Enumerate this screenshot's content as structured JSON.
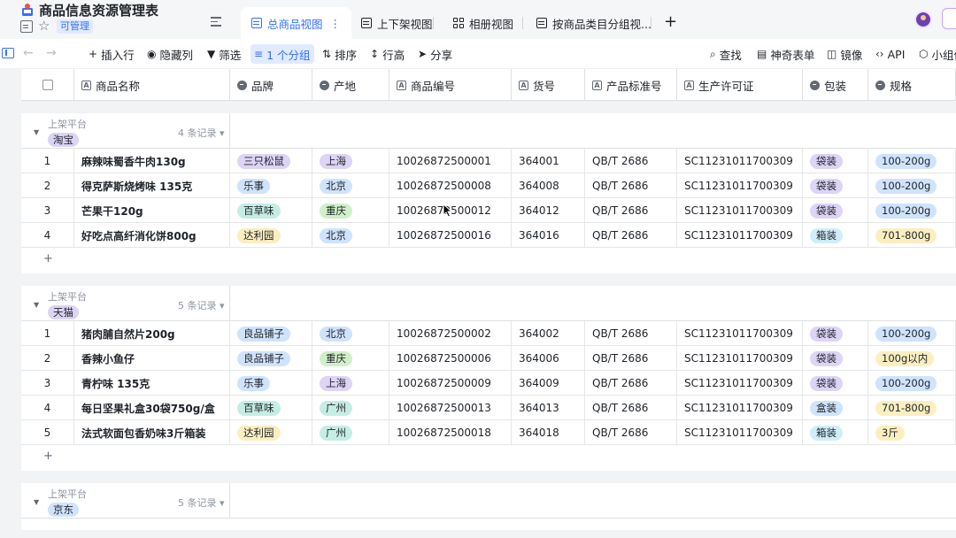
{
  "app": {
    "title": "商品信息资源管理表",
    "permission_badge": "可管理"
  },
  "tabs": [
    {
      "label": "总商品视图",
      "active": true,
      "icon": "grid-view-icon"
    },
    {
      "label": "上下架视图",
      "active": false,
      "icon": "grid-view-icon"
    },
    {
      "label": "相册视图",
      "active": false,
      "icon": "gallery-view-icon"
    },
    {
      "label": "按商品类目分组视...",
      "active": false,
      "icon": "grid-view-icon"
    }
  ],
  "toolbar": {
    "insert_row": "插入行",
    "hide_columns": "隐藏列",
    "filter": "筛选",
    "group": "1 个分组",
    "sort": "排序",
    "row_height": "行高",
    "share": "分享",
    "search": "查找",
    "magic_form": "神奇表单",
    "mirror": "镜像",
    "api": "API",
    "widget": "小组件"
  },
  "columns": [
    "商品名称",
    "品牌",
    "产地",
    "商品编号",
    "货号",
    "产品标准号",
    "生产许可证",
    "包装",
    "规格"
  ],
  "colors": {
    "accent": "#3370ff",
    "brand": {
      "三只松鼠": "#ddd4f7",
      "乐事": "#d0e3fc",
      "百草味": "#c5ede3",
      "达利园": "#fbefc0",
      "良品铺子": "#d0e3fc"
    },
    "origin": {
      "上海": "#ddd4f7",
      "北京": "#d0e3fc",
      "重庆": "#d0f0c8",
      "广州": "#c5ede3"
    },
    "package": {
      "袋装": "#ddd4f7",
      "箱装": "#d0eef9",
      "盒装": "#d0e3fc"
    },
    "spec": {
      "100-200g": "#d0e3fc",
      "701-800g": "#fbefc0",
      "100g以内": "#fbefc0",
      "3斤": "#fbefc0"
    }
  },
  "groups": [
    {
      "field": "上架平台",
      "tag": "淘宝",
      "tag_color": "#dcd3f5",
      "count_label": "4 条记录",
      "rows": [
        {
          "idx": "1",
          "name": "麻辣味蜀香牛肉130g",
          "brand": "三只松鼠",
          "origin": "上海",
          "code": "10026872500001",
          "sku": "364001",
          "std": "QB/T 2686",
          "license": "SC11231011700309",
          "package": "袋装",
          "spec": "100-200g"
        },
        {
          "idx": "2",
          "name": "得克萨斯烧烤味 135克",
          "brand": "乐事",
          "origin": "北京",
          "code": "10026872500008",
          "sku": "364008",
          "std": "QB/T 2686",
          "license": "SC11231011700309",
          "package": "袋装",
          "spec": "100-200g"
        },
        {
          "idx": "3",
          "name": "芒果干120g",
          "brand": "百草味",
          "origin": "重庆",
          "code": "10026872500012",
          "sku": "364012",
          "std": "QB/T 2686",
          "license": "SC11231011700309",
          "package": "袋装",
          "spec": "100-200g"
        },
        {
          "idx": "4",
          "name": "好吃点高纤消化饼800g",
          "brand": "达利园",
          "origin": "北京",
          "code": "10026872500016",
          "sku": "364016",
          "std": "QB/T 2686",
          "license": "SC11231011700309",
          "package": "箱装",
          "spec": "701-800g"
        }
      ]
    },
    {
      "field": "上架平台",
      "tag": "天猫",
      "tag_color": "#dcd3f5",
      "count_label": "5 条记录",
      "rows": [
        {
          "idx": "1",
          "name": "猪肉脯自然片200g",
          "brand": "良品铺子",
          "origin": "北京",
          "code": "10026872500002",
          "sku": "364002",
          "std": "QB/T 2686",
          "license": "SC11231011700309",
          "package": "袋装",
          "spec": "100-200g"
        },
        {
          "idx": "2",
          "name": "香辣小鱼仔",
          "brand": "良品铺子",
          "origin": "重庆",
          "code": "10026872500006",
          "sku": "364006",
          "std": "QB/T 2686",
          "license": "SC11231011700309",
          "package": "袋装",
          "spec": "100g以内"
        },
        {
          "idx": "3",
          "name": "青柠味 135克",
          "brand": "乐事",
          "origin": "上海",
          "code": "10026872500009",
          "sku": "364009",
          "std": "QB/T 2686",
          "license": "SC11231011700309",
          "package": "袋装",
          "spec": "100-200g"
        },
        {
          "idx": "4",
          "name": "每日坚果礼盒30袋750g/盒",
          "brand": "百草味",
          "origin": "广州",
          "code": "10026872500013",
          "sku": "364013",
          "std": "QB/T 2686",
          "license": "SC11231011700309",
          "package": "盒装",
          "spec": "701-800g"
        },
        {
          "idx": "5",
          "name": "法式软面包香奶味3斤箱装",
          "brand": "达利园",
          "origin": "广州",
          "code": "10026872500018",
          "sku": "364018",
          "std": "QB/T 2686",
          "license": "SC11231011700309",
          "package": "箱装",
          "spec": "3斤"
        }
      ]
    },
    {
      "field": "上架平台",
      "tag": "京东",
      "tag_color": "#d0e3fc",
      "count_label": "5 条记录",
      "rows": []
    }
  ]
}
